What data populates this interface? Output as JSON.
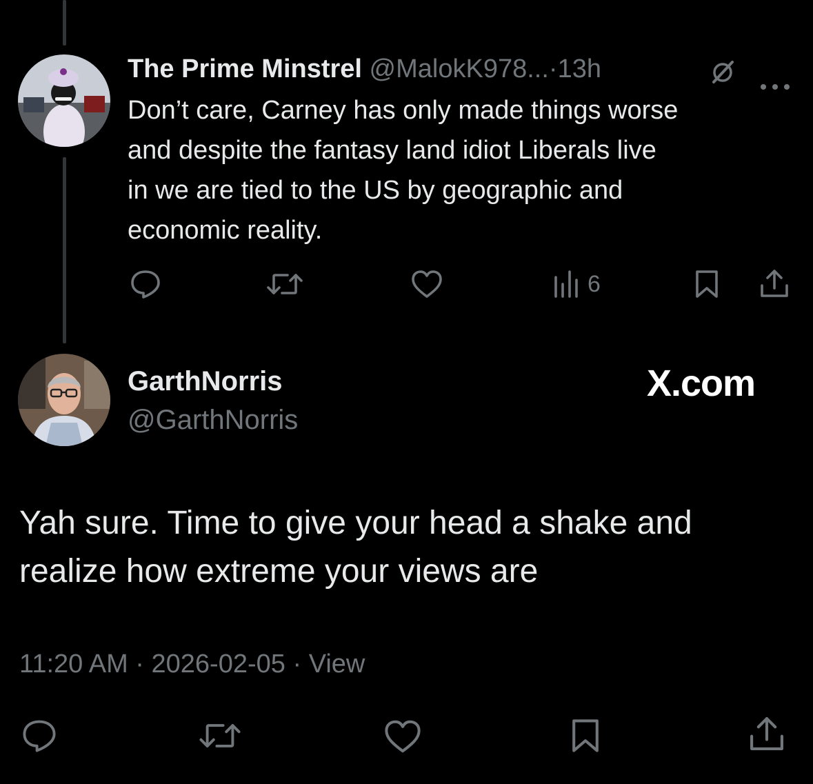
{
  "reply": {
    "display_name": "The Prime Minstrel",
    "handle": "@MalokK978...",
    "separator": "·",
    "time": "13h",
    "text": "Don’t care, Carney has only made things worse\nand despite the fantasy land idiot Liberals live\nin we are tied to the US by geographic and\neconomic reality.",
    "views": "6",
    "icons": [
      "grok-icon",
      "more-icon",
      "reply-icon",
      "repost-icon",
      "like-icon",
      "views-icon",
      "bookmark-icon",
      "share-icon"
    ]
  },
  "main_post": {
    "display_name": "GarthNorris",
    "handle": "@GarthNorris",
    "brand": "X.com",
    "text": "Yah sure. Time to give your head a shake and\nrealize how extreme your views are",
    "timestamp": "11:20 AM",
    "separator": "·",
    "date": "2026-02-05",
    "view_label": "View",
    "icons": [
      "reply-icon",
      "repost-icon",
      "like-icon",
      "bookmark-icon",
      "share-icon"
    ]
  },
  "colors": {
    "background": "#000000",
    "primary_text": "#e7e9ea",
    "secondary_text": "#71767b",
    "thread_line": "#333639"
  }
}
